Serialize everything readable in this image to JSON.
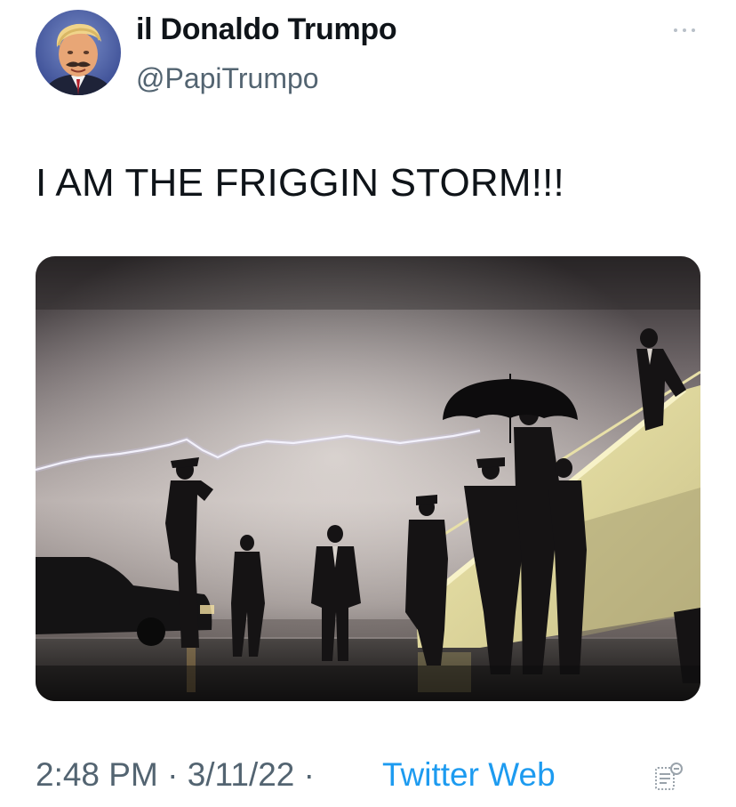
{
  "tweet": {
    "author": {
      "display_name": "il Donaldo Trumpo",
      "handle": "@PapiTrumpo",
      "avatar_icon": "profile-photo"
    },
    "text": "I AM THE FRIGGIN STORM!!!",
    "media": {
      "kind": "photo",
      "subject": "lightning over airport tarmac with figures and aircraft stairs"
    },
    "time": "2:48 PM",
    "separator": "·",
    "date": "3/11/22",
    "source": "Twitter Web",
    "more_icon": "more-dots-icon",
    "analytics_icon": "analytics-icon"
  },
  "colors": {
    "text": "#0f1419",
    "secondary": "#536471",
    "link": "#1d9bf0",
    "background": "#ffffff"
  }
}
